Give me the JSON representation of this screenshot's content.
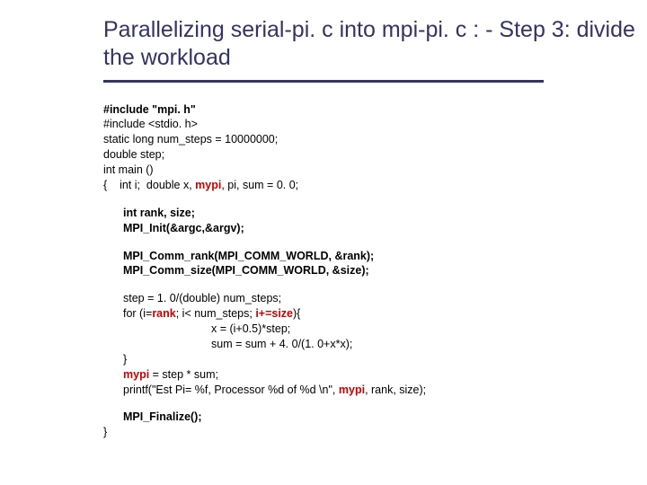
{
  "title": "Parallelizing serial-pi. c into mpi-pi. c : - Step 3: divide the workload",
  "code": {
    "l1a": "#include \"mpi. h\"",
    "l2": "#include <stdio. h>",
    "l3": "static long num_steps = 10000000;",
    "l4": "double step;",
    "l5": "int main ()",
    "l6a": "{    int i;  double x, ",
    "l6b": "mypi",
    "l6c": ", pi, sum = 0. 0;",
    "l7a": "int rank, size;",
    "l7b": "MPI_Init(&argc,&argv);",
    "l8a": "MPI_Comm_rank(MPI_COMM_WORLD, &rank);",
    "l8b": "MPI_Comm_size(MPI_COMM_WORLD, &size);",
    "l9": "step = 1. 0/(double) num_steps;",
    "l10a": "for (i=",
    "l10b": "rank",
    "l10c": "; i< num_steps; ",
    "l10d": "i+=size",
    "l10e": "){",
    "l11": "x = (i+0.5)*step;",
    "l12": "sum = sum + 4. 0/(1. 0+x*x);",
    "l13": "}",
    "l14a": "mypi",
    "l14b": " = step * sum;",
    "l15a": "printf(\"Est Pi= %f, Processor %d of %d \\n\", ",
    "l15b": "mypi",
    "l15c": ", rank, size);",
    "l16": "MPI_Finalize();",
    "l17": "}"
  }
}
